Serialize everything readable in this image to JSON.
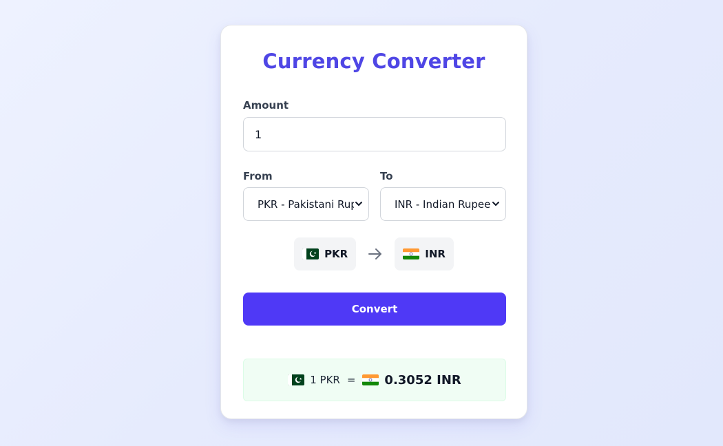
{
  "title": "Currency Converter",
  "amount": {
    "label": "Amount",
    "value": "1"
  },
  "from": {
    "label": "From",
    "selected": "PKR - Pakistani Rupee"
  },
  "to": {
    "label": "To",
    "selected": "INR - Indian Rupee"
  },
  "pair": {
    "from_code": "PKR",
    "from_flag": "pakistan-flag-icon",
    "to_code": "INR",
    "to_flag": "india-flag-icon",
    "arrow": "arrow-right-icon"
  },
  "convert": {
    "label": "Convert"
  },
  "result": {
    "from_text": "1 PKR",
    "equals": "=",
    "to_text": "0.3052 INR"
  },
  "colors": {
    "accent": "#4f46e5",
    "button": "#4f39f6",
    "result_bg": "#f0fdf4"
  }
}
